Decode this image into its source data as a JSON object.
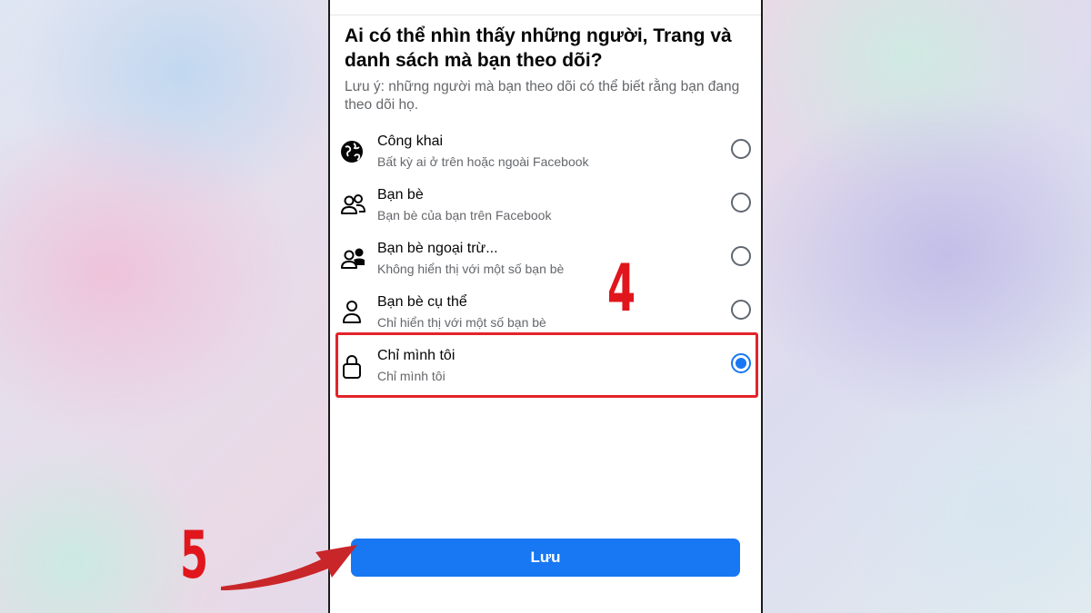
{
  "dialog": {
    "title": "Ai có thể nhìn thấy những người, Trang và danh sách mà bạn theo dõi?",
    "note": "Lưu ý: những người mà bạn theo dõi có thể biết rằng bạn đang theo dõi họ.",
    "options": [
      {
        "label": "Công khai",
        "sub": "Bất kỳ ai ở trên hoặc ngoài Facebook",
        "icon": "globe-icon",
        "selected": false
      },
      {
        "label": "Bạn bè",
        "sub": "Bạn bè của bạn trên Facebook",
        "icon": "friends-icon",
        "selected": false
      },
      {
        "label": "Bạn bè ngoại trừ...",
        "sub": "Không hiển thị với một số bạn bè",
        "icon": "friends-except-icon",
        "selected": false
      },
      {
        "label": "Bạn bè cụ thể",
        "sub": "Chỉ hiển thị với một số bạn bè",
        "icon": "person-icon",
        "selected": false
      },
      {
        "label": "Chỉ mình tôi",
        "sub": "Chỉ mình tôi",
        "icon": "lock-icon",
        "selected": true
      }
    ],
    "save_label": "Lưu"
  },
  "annotations": {
    "step4": "4",
    "step5": "5"
  },
  "colors": {
    "accent": "#1877f2",
    "highlight": "#e32329",
    "annotation": "#e0161c"
  }
}
